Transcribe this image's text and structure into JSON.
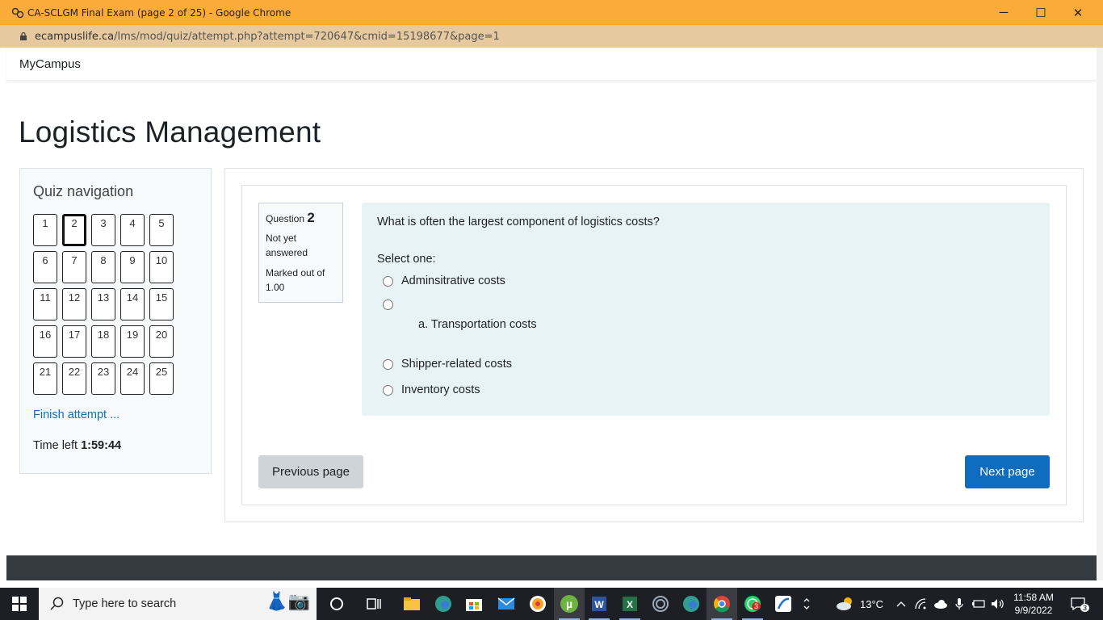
{
  "window": {
    "title": "CA-SCLGM Final Exam (page 2 of 25) - Google Chrome",
    "minimize": "─",
    "maximize": "☐",
    "close": "✕"
  },
  "address": {
    "host": "ecampuslife.ca",
    "path": "/lms/mod/quiz/attempt.php?attempt=720647&cmid=15198677&page=1"
  },
  "navbar": {
    "brand": "MyCampus"
  },
  "page": {
    "heading": "Logistics Management"
  },
  "quiz_nav": {
    "title": "Quiz navigation",
    "current": 2,
    "buttons": [
      "1",
      "2",
      "3",
      "4",
      "5",
      "6",
      "7",
      "8",
      "9",
      "10",
      "11",
      "12",
      "13",
      "14",
      "15",
      "16",
      "17",
      "18",
      "19",
      "20",
      "21",
      "22",
      "23",
      "24",
      "25"
    ],
    "finish_link": "Finish attempt ...",
    "time_left_label": "Time left",
    "time_left_value": "1:59:44"
  },
  "question": {
    "label": "Question",
    "number": "2",
    "state": "Not yet answered",
    "grade": "Marked out of 1.00",
    "text": "What is often the largest component of logistics costs?",
    "prompt": "Select one:",
    "options": [
      "Adminsitrative costs",
      "a. Transportation costs",
      "Shipper-related costs",
      "Inventory costs"
    ]
  },
  "buttons": {
    "previous": "Previous page",
    "next": "Next page"
  },
  "taskbar": {
    "search_placeholder": "Type here to search",
    "weather_temp": "13°C",
    "time": "11:58 AM",
    "date": "9/9/2022",
    "whatsapp_badge": "3",
    "notifications_badge": "3"
  },
  "colors": {
    "titlebar": "#fbab3a",
    "addressbar": "#e7c99f",
    "accent": "#0f6cbf",
    "question_bg": "#e7f3f5",
    "taskbar": "#1d1f25"
  }
}
